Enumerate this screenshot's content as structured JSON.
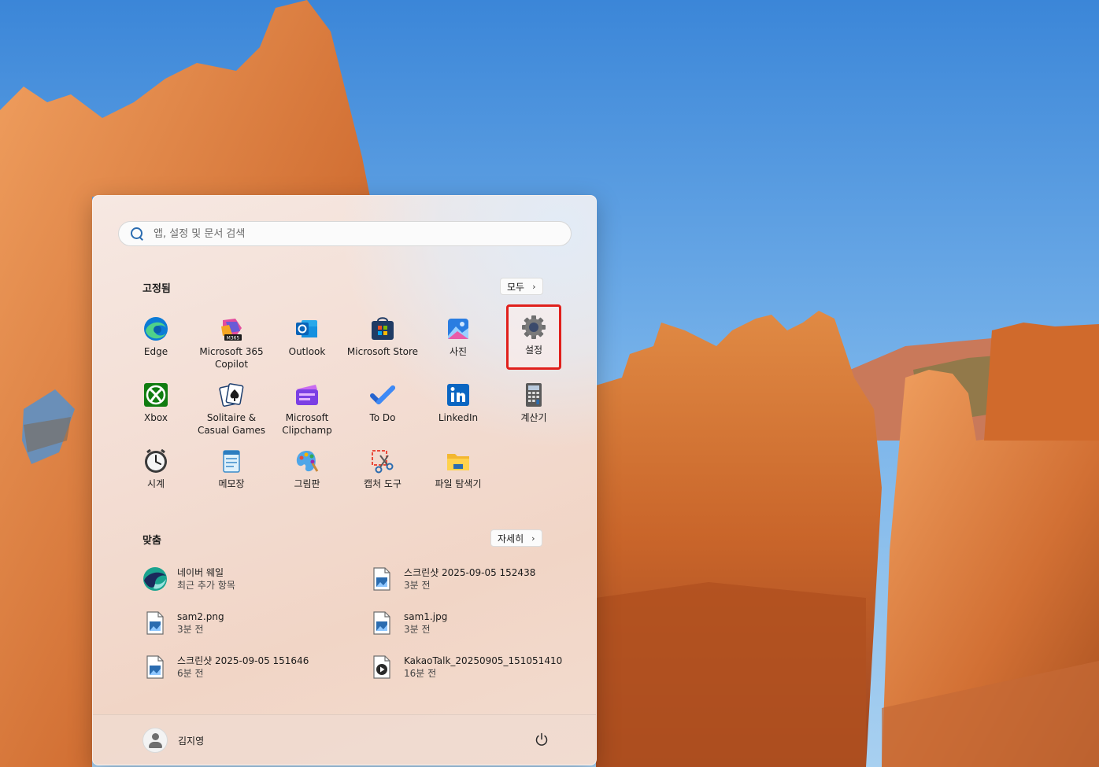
{
  "search": {
    "placeholder": "앱, 설정 및 문서 검색"
  },
  "pinned": {
    "title": "고정됨",
    "all_button": "모두",
    "apps": [
      {
        "label": "Edge",
        "icon": "edge-icon"
      },
      {
        "label": "Microsoft 365\nCopilot",
        "icon": "m365-copilot-icon"
      },
      {
        "label": "Outlook",
        "icon": "outlook-icon"
      },
      {
        "label": "Microsoft Store",
        "icon": "store-icon"
      },
      {
        "label": "사진",
        "icon": "photos-icon"
      },
      {
        "label": "설정",
        "icon": "settings-gear-icon",
        "highlighted": true
      },
      {
        "label": "Xbox",
        "icon": "xbox-icon"
      },
      {
        "label": "Solitaire &\nCasual Games",
        "icon": "solitaire-icon"
      },
      {
        "label": "Microsoft\nClipchamp",
        "icon": "clipchamp-icon"
      },
      {
        "label": "To Do",
        "icon": "todo-check-icon"
      },
      {
        "label": "LinkedIn",
        "icon": "linkedin-icon"
      },
      {
        "label": "계산기",
        "icon": "calculator-icon"
      },
      {
        "label": "시계",
        "icon": "clock-icon"
      },
      {
        "label": "메모장",
        "icon": "notepad-icon"
      },
      {
        "label": "그림판",
        "icon": "paint-palette-icon"
      },
      {
        "label": "캡처 도구",
        "icon": "snipping-tool-icon"
      },
      {
        "label": "파일 탐색기",
        "icon": "file-explorer-folder-icon"
      }
    ]
  },
  "recommended": {
    "title": "맞춤",
    "more_button": "자세히",
    "items": [
      {
        "name": "네이버 웨일",
        "sub": "최근 추가 항목",
        "icon": "whale-browser-icon"
      },
      {
        "name": "스크린샷 2025-09-05 152438",
        "sub": "3분 전",
        "icon": "image-file-icon"
      },
      {
        "name": "sam2.png",
        "sub": "3분 전",
        "icon": "image-file-icon"
      },
      {
        "name": "sam1.jpg",
        "sub": "3분 전",
        "icon": "image-file-icon"
      },
      {
        "name": "스크린샷 2025-09-05 151646",
        "sub": "6분 전",
        "icon": "image-file-icon"
      },
      {
        "name": "KakaoTalk_20250905_151051410",
        "sub": "16분 전",
        "icon": "video-file-icon"
      }
    ]
  },
  "footer": {
    "user_name": "김지영"
  },
  "colors": {
    "highlight": "#e0201c",
    "accent": "#2b6cb0"
  }
}
